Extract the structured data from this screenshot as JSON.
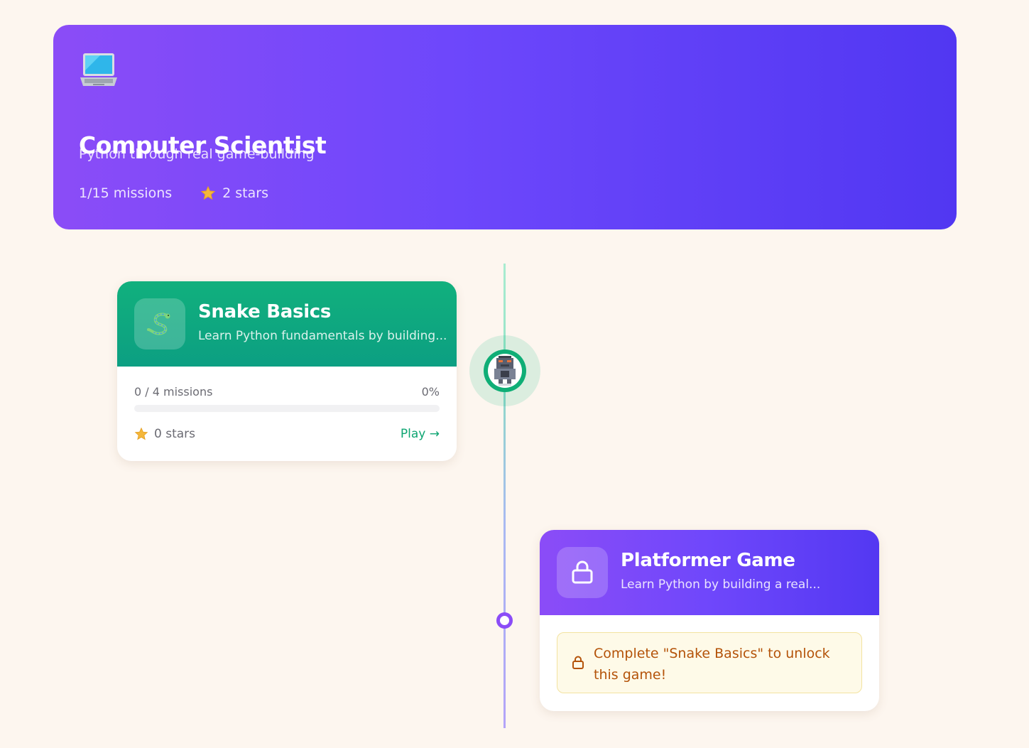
{
  "hero": {
    "icon": "laptop-icon",
    "title": "Computer Scientist",
    "subtitle": "Python through real game-building",
    "missions": "1/15 missions",
    "stars": "2 stars"
  },
  "games": [
    {
      "title": "Snake Basics",
      "description": "Learn Python fundamentals by building...",
      "icon": "snake-icon",
      "missions": "0 / 4 missions",
      "percent": "0%",
      "progress_fraction": 0,
      "stars": "0 stars",
      "play_label": "Play →",
      "accent": "#10b981"
    },
    {
      "title": "Platformer Game",
      "description": "Learn Python by building a real...",
      "icon": "lock-icon",
      "locked_message": "Complete \"Snake Basics\" to unlock this game!",
      "accent": "#7c4dfa"
    }
  ],
  "avatar": {
    "icon": "robot-avatar-icon"
  },
  "colors": {
    "background": "#fdf6ef",
    "hero_gradient_start": "#8b4cf7",
    "hero_gradient_end": "#5137f2",
    "star": "#f4b73b",
    "lock_text": "#b45309"
  }
}
